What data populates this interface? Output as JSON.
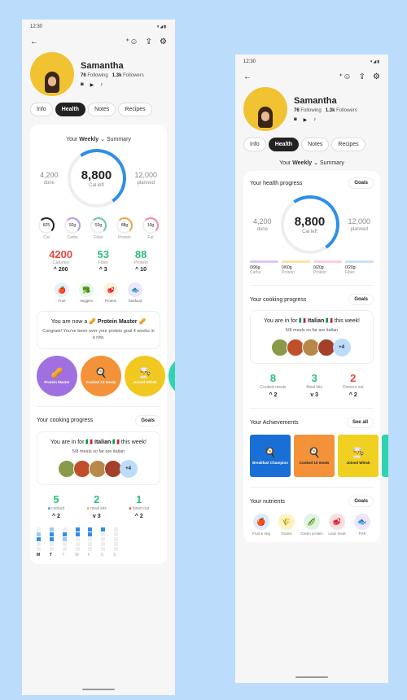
{
  "status": {
    "time": "12:30",
    "icons": "▾◢▮"
  },
  "profile": {
    "name": "Samantha",
    "following_count": "76",
    "following_label": "Following",
    "followers_count": "1.3k",
    "followers_label": "Followers"
  },
  "tabs": [
    "Info",
    "Health",
    "Notes",
    "Recipes"
  ],
  "left": {
    "selector": {
      "prefix": "Your",
      "period": "Weekly",
      "suffix": "Summary"
    },
    "calories": {
      "done_value": "4,200",
      "done_label": "done",
      "left_value": "8,800",
      "left_label": "Cal left",
      "planned_value": "12,000",
      "planned_label": "planned"
    },
    "minis": [
      {
        "value": "825",
        "label": "Cal",
        "color": "#222222"
      },
      {
        "value": "92g",
        "label": "Carbs",
        "color": "#b49be8"
      },
      {
        "value": "53g",
        "label": "Fiber",
        "color": "#6cc5a8"
      },
      {
        "value": "88g",
        "label": "Protein",
        "color": "#f4a340"
      },
      {
        "value": "10g",
        "label": "Fat",
        "color": "#f08aa8"
      }
    ],
    "nums": [
      {
        "value": "4200",
        "label": "Calories",
        "delta": "^ 200",
        "color": "#e8463c"
      },
      {
        "value": "53",
        "label": "Fiber",
        "delta": "^ 3",
        "color": "#2fbf7a"
      },
      {
        "value": "88",
        "label": "Protein",
        "delta": "^ 10",
        "color": "#2fbf7a"
      }
    ],
    "categories": [
      {
        "label": "Fruit",
        "icon": "🍎",
        "bg": "#e6f0fb"
      },
      {
        "label": "Veggies",
        "icon": "🥦",
        "bg": "#e6f7ec"
      },
      {
        "label": "Protein",
        "icon": "🥩",
        "bg": "#fbf3dd"
      },
      {
        "label": "Seafood",
        "icon": "🐟",
        "bg": "#ece6f8"
      }
    ],
    "note": {
      "title_prefix": "You are now a",
      "title_bold": "Protein Master",
      "text": "Congrats! You've been over your protein goal 4 weeks in a row."
    },
    "badges": [
      {
        "label": "Protein Master",
        "icon": "🥜",
        "bg": "#a070e0"
      },
      {
        "label": "Cooked 10 meals",
        "icon": "🍳",
        "bg": "#f4923a"
      },
      {
        "label": "Joined Whisk",
        "icon": "👨‍🍳",
        "bg": "#f0c820"
      },
      {
        "label": "",
        "icon": "",
        "bg": "#2fd3b0"
      }
    ],
    "cooking": {
      "title": "Your cooking progress",
      "goals": "Goals",
      "head_prefix": "You are in for",
      "cuisine": "Italian",
      "head_suffix": "this week!",
      "sub": "5/8 meals so far are italian",
      "more": "+4",
      "stats": [
        {
          "value": "5",
          "label": "cooked",
          "delta": "^ 2",
          "color": "#2fbf7a",
          "dot": "#2f8fe8"
        },
        {
          "value": "2",
          "label": "meal kits",
          "delta": "v 3",
          "color": "#2fbf7a",
          "dot": "#f4a340"
        },
        {
          "value": "1",
          "label": "dined out",
          "delta": "^ 2",
          "color": "#2fbf7a",
          "dot": "#e8463c"
        }
      ],
      "days": [
        "M",
        "T",
        "T",
        "W",
        "F",
        "S",
        "S"
      ]
    }
  },
  "right": {
    "health": {
      "title": "Your health progress",
      "goals": "Goals",
      "done_value": "4,200",
      "done_label": "done",
      "left_value": "8,800",
      "left_label": "Cal left",
      "planned_value": "12,000",
      "planned_label": "planned",
      "bars": [
        {
          "value": "0/96g",
          "label": "Carbs",
          "color": "#d8c8f2"
        },
        {
          "value": "0/60g",
          "label": "Protein",
          "color": "#fae3a8"
        },
        {
          "value": "0/20g",
          "label": "Protein",
          "color": "#f8d0dc"
        },
        {
          "value": "0/20g",
          "label": "Fiber",
          "color": "#c8e0f8"
        }
      ]
    },
    "cooking": {
      "title": "Your cooking progress",
      "goals": "Goals",
      "head_prefix": "You are in for",
      "cuisine": "Italian",
      "head_suffix": "this week!",
      "sub": "5/8 meals so far are italian",
      "more": "+4",
      "stats": [
        {
          "value": "8",
          "label": "Cooked meals",
          "delta": "^ 2",
          "color": "#2fbf7a"
        },
        {
          "value": "3",
          "label": "Meal kits",
          "delta": "v 3",
          "color": "#2fbf7a"
        },
        {
          "value": "2",
          "label": "Dinners out",
          "delta": "^ 2",
          "color": "#e8463c"
        }
      ]
    },
    "achievements": {
      "title": "Your Achievements",
      "see_all": "See all",
      "items": [
        {
          "label": "Breakfast Champion",
          "icon": "🍳",
          "bg": "#1a6fd6",
          "fg": "#ffffff"
        },
        {
          "label": "Cooked 10 meals",
          "icon": "🍳",
          "bg": "#f4923a",
          "fg": "#222222"
        },
        {
          "label": "Joined Whisk",
          "icon": "👨‍🍳",
          "bg": "#f0d020",
          "fg": "#222222"
        },
        {
          "label": "",
          "icon": "",
          "bg": "#2fd3b0",
          "fg": "#ffffff"
        }
      ]
    },
    "nutrients": {
      "title": "Your nutrients",
      "goals": "Goals",
      "items": [
        {
          "label": "Fruit & Veg",
          "icon": "🍎",
          "bg": "#dcebfb"
        },
        {
          "label": "Grains",
          "icon": "🌾",
          "bg": "#fbf3c0"
        },
        {
          "label": "Green protein",
          "icon": "🫛",
          "bg": "#e0f3e4"
        },
        {
          "label": "Lean meat",
          "icon": "🥩",
          "bg": "#fbe0e0"
        },
        {
          "label": "Fish",
          "icon": "🐟",
          "bg": "#ece6f8"
        }
      ]
    }
  }
}
